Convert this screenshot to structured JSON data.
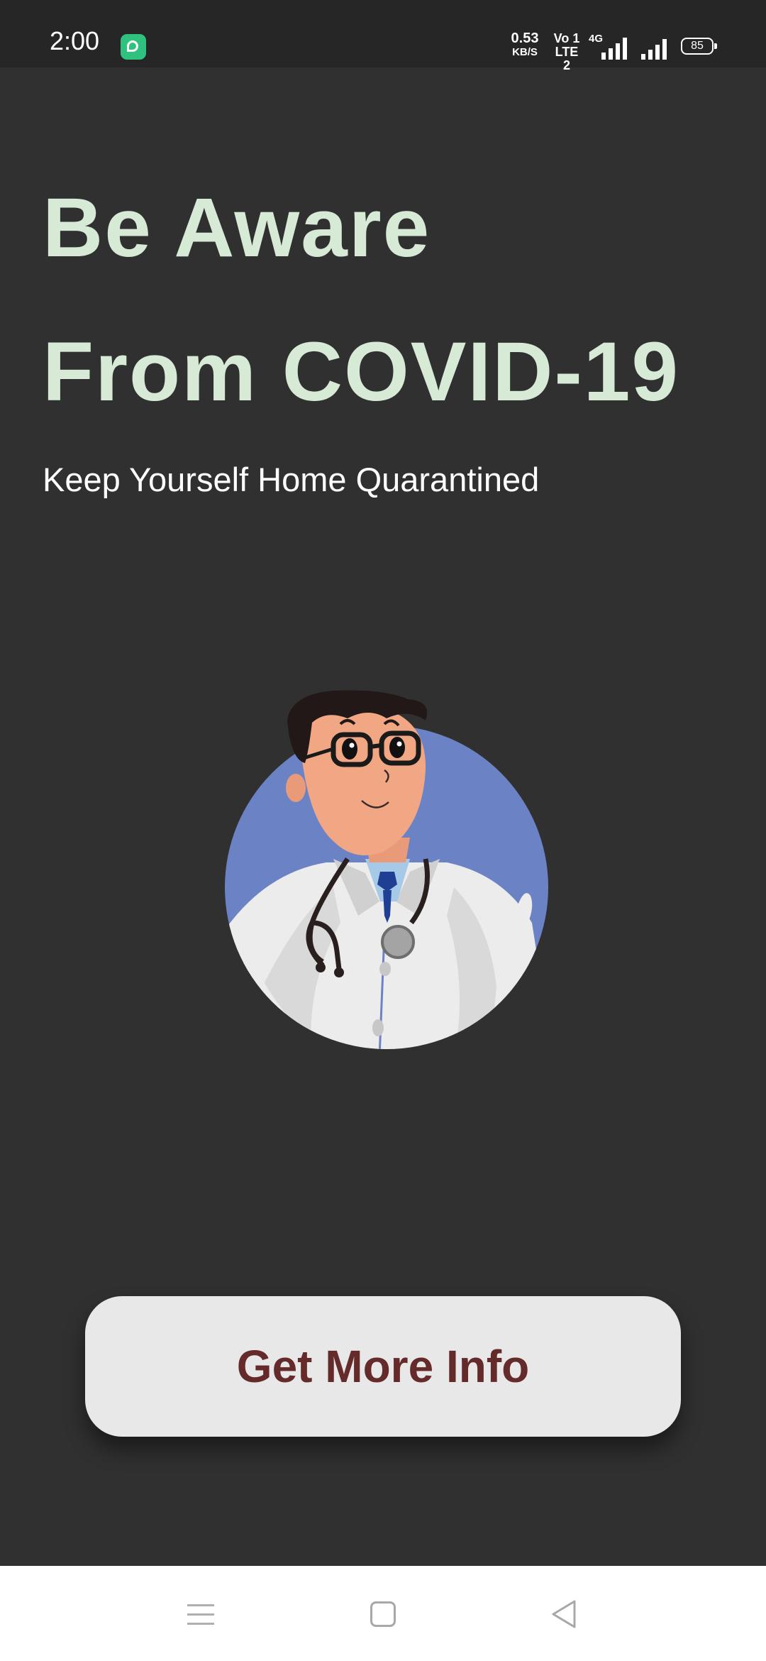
{
  "status_bar": {
    "time": "2:00",
    "network_speed_value": "0.53",
    "network_speed_unit": "KB/S",
    "volte_top": "Vo 1",
    "volte_bottom": "LTE 2",
    "network_type": "4G",
    "battery_level": "85",
    "app_icon": "chat-bubble-icon"
  },
  "main": {
    "headline_line1": "Be Aware",
    "headline_line2": "From COVID-19",
    "subtitle": "Keep Yourself Home Quarantined",
    "illustration": "doctor-illustration"
  },
  "cta": {
    "label": "Get More Info"
  },
  "nav_bar": {
    "menu_icon": "menu-icon",
    "home_icon": "home-square-icon",
    "back_icon": "back-triangle-icon"
  },
  "colors": {
    "background": "#303030",
    "headline": "#d6ead6",
    "button_bg": "#e8e8e8",
    "button_text": "#652a2a",
    "illustration_circle": "#6b83c4"
  }
}
